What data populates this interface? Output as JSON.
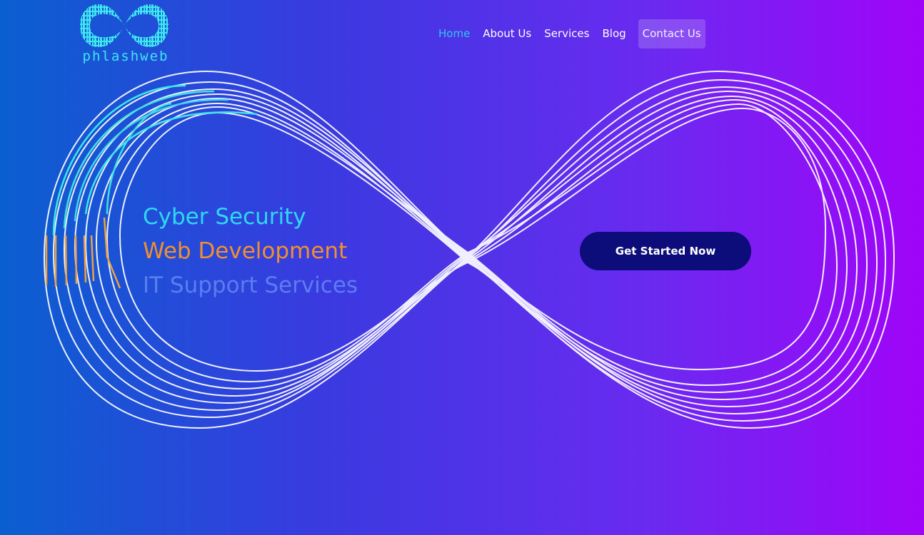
{
  "brand": {
    "name": "phlashweb",
    "logo_icon": "infinity-binary-logo",
    "accent": "#3ee6f0"
  },
  "nav": {
    "items": [
      {
        "label": "Home",
        "active": true
      },
      {
        "label": "About Us",
        "active": false
      },
      {
        "label": "Services",
        "active": false
      },
      {
        "label": "Blog",
        "active": false
      }
    ],
    "contact_label": "Contact Us",
    "active_color": "#2ec8f0"
  },
  "hero": {
    "lines": [
      {
        "text": "Cyber Security",
        "color": "#2fd8f2"
      },
      {
        "text": "Web Development",
        "color": "#f09030"
      },
      {
        "text": "IT Support Services",
        "color": "#5b7ef0"
      }
    ],
    "cta_label": "Get Started Now",
    "cta_color": "#0c0c7a",
    "decoration_icon": "infinity-loops-graphic"
  },
  "background": {
    "gradient_start": "#0a5fd0",
    "gradient_end": "#a004f8"
  }
}
